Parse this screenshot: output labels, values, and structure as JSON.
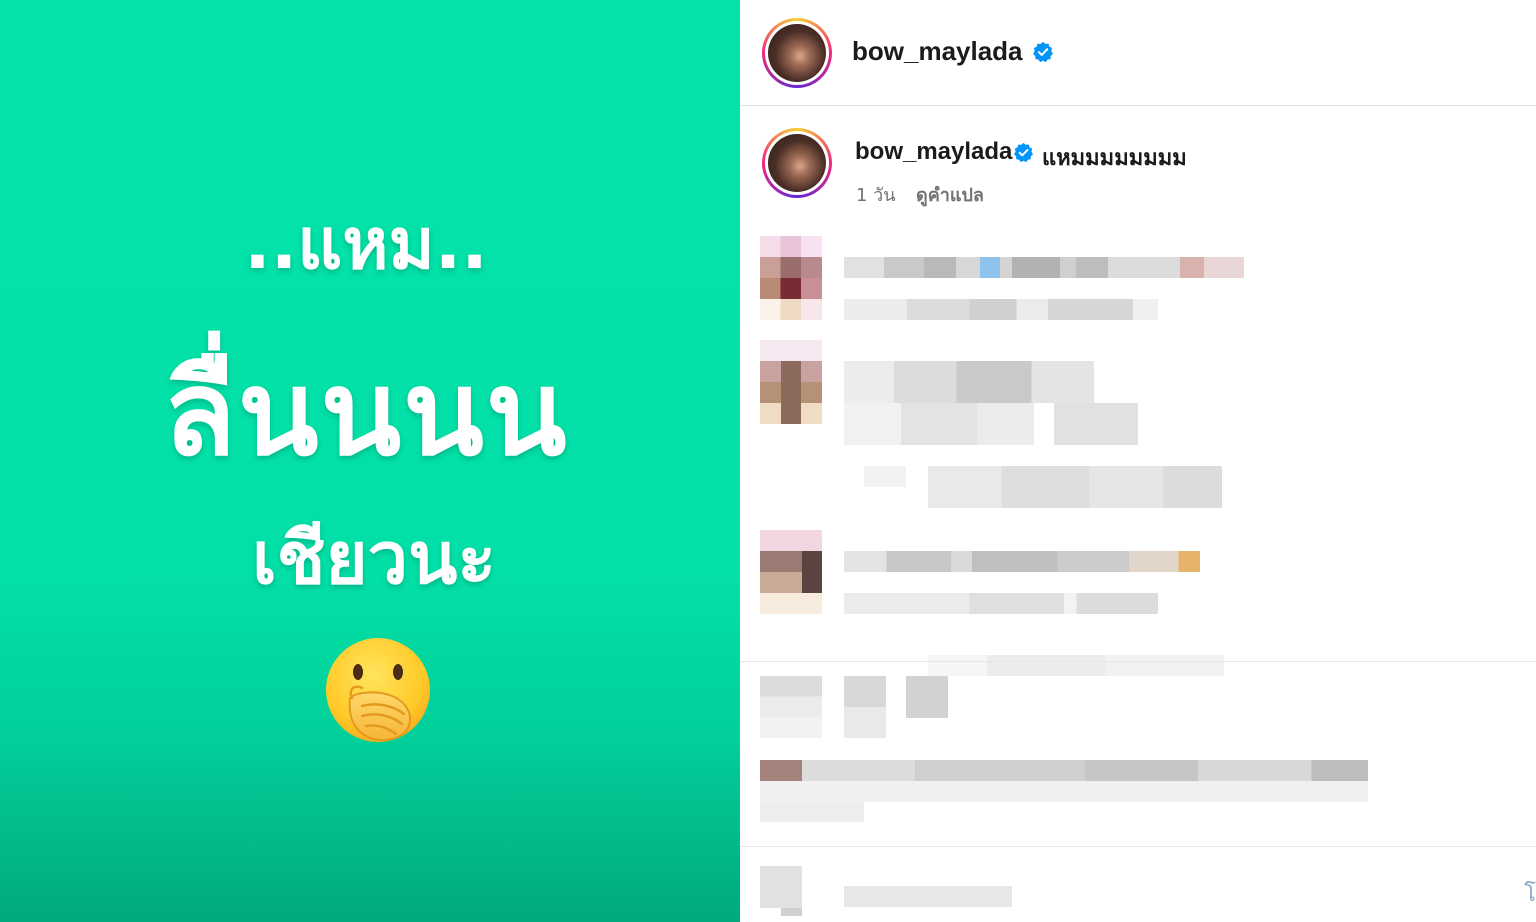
{
  "post": {
    "background_color": "#03e0a7",
    "text_lines": [
      "..แหม..",
      "ลื่นนนน",
      "เชียวนะ"
    ],
    "emoji": "face-with-hand-over-mouth-emoji"
  },
  "header": {
    "username": "bow_maylada",
    "verified_icon": "verified-badge-icon",
    "accent_color": "#0095f6"
  },
  "caption": {
    "username": "bow_maylada",
    "text": "แหมมมมมมมม",
    "time": "1 วัน",
    "translate_label": "ดูคำแปล"
  },
  "edge_glyph": "โ"
}
